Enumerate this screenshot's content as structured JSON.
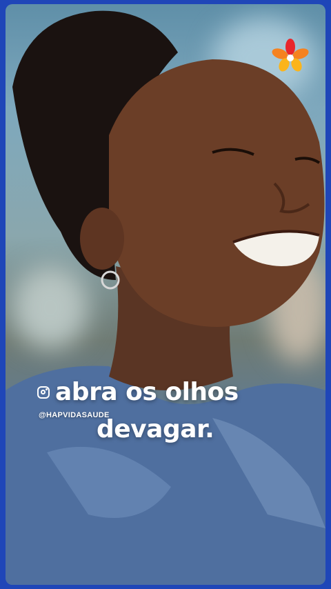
{
  "caption": {
    "line1": "abra os olhos",
    "line2": "devagar.",
    "handle": "@HAPVIDASAUDE"
  },
  "icons": {
    "social": "instagram-icon",
    "brand": "hapvida-flower-logo"
  },
  "colors": {
    "frame": "#1f46b8",
    "caption_text": "#ffffff",
    "logo_red": "#e8262c",
    "logo_orange": "#f58220",
    "logo_yellow": "#fbb41a"
  }
}
